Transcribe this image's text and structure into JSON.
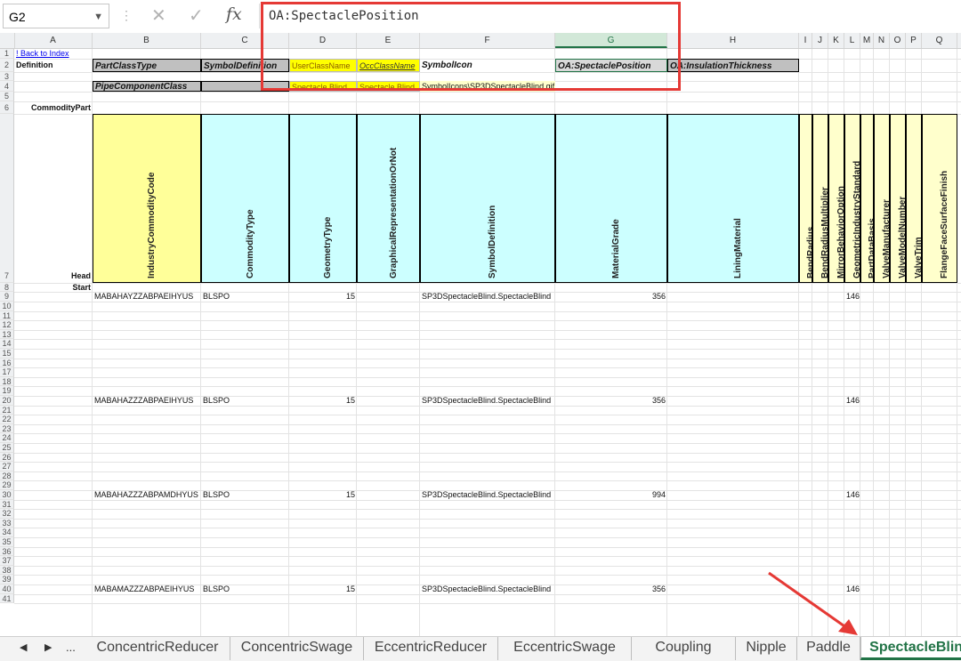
{
  "formula_bar": {
    "name_box": "G2",
    "formula": "OA:SpectaclePosition"
  },
  "columns": [
    "A",
    "B",
    "C",
    "D",
    "E",
    "F",
    "G",
    "H",
    "I",
    "J",
    "K",
    "L",
    "M",
    "N",
    "O",
    "P",
    "Q"
  ],
  "rows": [
    "1",
    "2",
    "3",
    "4",
    "5",
    "6",
    "7",
    "8",
    "9",
    "10",
    "11",
    "12",
    "13",
    "14",
    "15",
    "16",
    "17",
    "18",
    "19",
    "20",
    "21",
    "22",
    "23",
    "24",
    "25",
    "26",
    "27",
    "28",
    "29",
    "30",
    "31",
    "32",
    "33",
    "34",
    "35",
    "36",
    "37",
    "38",
    "39",
    "40",
    "41"
  ],
  "cells": {
    "back_link": "! Back to Index",
    "definition": "Definition",
    "part_class_type": "PartClassType",
    "symbol_definition": "SymbolDefinition",
    "user_class_name": "UserClassName",
    "occ_class_name": "OccClassName",
    "symbol_icon": "SymbolIcon",
    "oa_spectacle_position": "OA:SpectaclePosition",
    "oa_insulation_thickness": "OA:InsulationThickness",
    "pipe_component_class": "PipeComponentClass",
    "d4": "Spectacle Blind",
    "e4": "Spectacle Blind",
    "f4": "SymbolIcons\\SP3DSpectacleBlind.gif",
    "commodity_part": "CommodityPart",
    "head": "Head",
    "start": "Start"
  },
  "headers": [
    "IndustryCommodityCode",
    "CommodityType",
    "GeometryType",
    "GraphicalRepresentationOrNot",
    "SymbolDefinition",
    "MaterialGrade",
    "LiningMaterial",
    "BendRadius",
    "BendRadiusMultiplier",
    "MirrorBehaviorOption",
    "GeometricIndustryStandard",
    "PartDataBasis",
    "ValveManufacturer",
    "ValveModelNumber",
    "ValveTrim",
    "FlangeFaceSurfaceFinish"
  ],
  "data_rows": [
    {
      "row": "9",
      "code": "MABAHAYZZABPAEIHYUS",
      "type": "BLSPO",
      "geom": "15",
      "symbol": "SP3DSpectacleBlind.SpectacleBlind",
      "grade": "356",
      "std": "146"
    },
    {
      "row": "20",
      "code": "MABAHAZZZABPAEIHYUS",
      "type": "BLSPO",
      "geom": "15",
      "symbol": "SP3DSpectacleBlind.SpectacleBlind",
      "grade": "356",
      "std": "146"
    },
    {
      "row": "30",
      "code": "MABAHAZZZABPAMDHYUS",
      "type": "BLSPO",
      "geom": "15",
      "symbol": "SP3DSpectacleBlind.SpectacleBlind",
      "grade": "994",
      "std": "146"
    },
    {
      "row": "40",
      "code": "MABAMAZZZABPAEIHYUS",
      "type": "BLSPO",
      "geom": "15",
      "symbol": "SP3DSpectacleBlind.SpectacleBlind",
      "grade": "356",
      "std": "146"
    }
  ],
  "tabs": [
    "ConcentricReducer",
    "ConcentricSwage",
    "EccentricReducer",
    "EccentricSwage",
    "Coupling",
    "Nipple",
    "Paddle",
    "SpectacleBlind"
  ],
  "active_tab": "SpectacleBlind",
  "nav": {
    "prev": "◀",
    "next": "▶",
    "more": "..."
  },
  "colors": {
    "accent": "#217346",
    "annotation": "#e53935"
  }
}
